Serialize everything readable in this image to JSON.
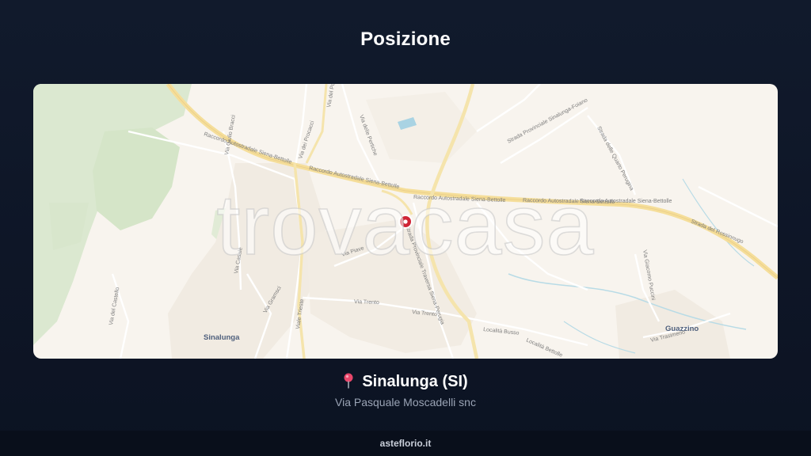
{
  "header": {
    "title": "Posizione"
  },
  "map": {
    "watermark": "trovacasa",
    "road_labels": {
      "raccordo_1": "Raccordo Autostradale Siena-Bettolle",
      "raccordo_2": "Raccordo Autostradale Siena-Bettolle",
      "raccordo_3": "Raccordo Autostradale Siena-Bettolle",
      "raccordo_4": "Raccordo Autostradale Siena-Bettolle",
      "raccordo_5": "Raccordo Autostradale Siena-Bettolle",
      "via_del_poggio": "Via del Poggio",
      "via_dei_procacci": "Via dei Procacci",
      "via_delle_pertiche": "Via delle Pertiche",
      "via_giulio_bracci": "Via Giulio Bracci",
      "via_piave": "Via Piave",
      "strada_provinciale": "Strada Provinciale Traversa Siena-Perugia",
      "via_trento_1": "Via Trento",
      "via_trento_2": "Via Trento",
      "viale_trieste": "Viale Trieste",
      "via_gramsci": "Via Gramsci",
      "localita_busso": "Località Busso",
      "localita_bettolle": "Località Bettolle",
      "via_trasimeno": "Via Trasimeno",
      "strada_rossinnugo": "Strada del Rossinnugo",
      "strada_sinalunga_foiano": "Strada Provinciale Sinalunga-Foiano",
      "strada_quarto": "Strada delle Quarto Perugina",
      "via_giacomo": "Via Giacomo Puccini",
      "via_del_castello": "Via del Castello",
      "via_casale": "Via Casale"
    },
    "place_labels": {
      "sinalunga": "Sinalunga",
      "guazzino": "Guazzino"
    }
  },
  "location": {
    "city": "Sinalunga (SI)",
    "address": "Via Pasquale Moscadelli snc"
  },
  "footer": {
    "site": "asteflorio.it"
  },
  "icons": {
    "location": "map-pin-icon",
    "marker": "map-marker-icon"
  },
  "colors": {
    "background": "#111a2c",
    "map_land": "#f8f4ee",
    "forest": "#dbe8d0",
    "highway": "#f5de9a",
    "marker": "#d02436"
  }
}
